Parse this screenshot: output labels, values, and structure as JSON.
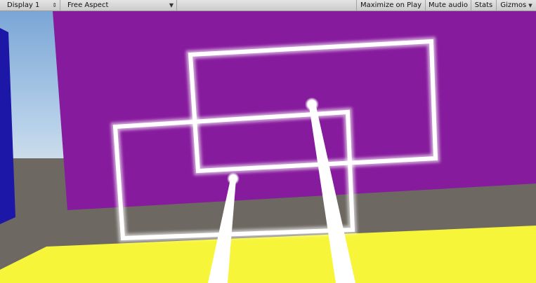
{
  "toolbar": {
    "display_select": "Display 1",
    "aspect_select": "Free Aspect",
    "maximize_on_play": "Maximize on Play",
    "mute_audio": "Mute audio",
    "stats": "Stats",
    "gizmos": "Gizmos"
  },
  "icons": {
    "display_arrow": "updown-arrow-icon",
    "aspect_arrow": "dropdown-arrow-icon",
    "gizmos_arrow": "dropdown-arrow-icon"
  },
  "colors": {
    "sky": "#86b3de",
    "purple_wall": "#871b9d",
    "blue_wall": "#1c17a6",
    "ground": "#6d6862",
    "yellow_floor": "#f7f53a",
    "frame_white": "#ffffff"
  }
}
